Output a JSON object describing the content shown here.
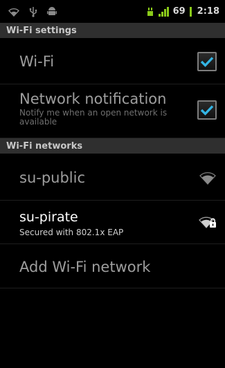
{
  "status_bar": {
    "battery_level": "69",
    "clock": "2:18",
    "icons": [
      "wifi-icon",
      "usb-icon",
      "android-debug-icon",
      "sim-icon",
      "signal-icon",
      "battery-icon"
    ]
  },
  "sections": {
    "wifi_settings": "Wi-Fi settings",
    "wifi_networks": "Wi-Fi networks"
  },
  "settings": {
    "wifi": {
      "label": "Wi-Fi",
      "checked": true
    },
    "network_notification": {
      "label": "Network notification",
      "summary": "Notify me when an open network is available",
      "checked": true
    }
  },
  "networks": [
    {
      "ssid": "su-public",
      "status": "",
      "secured": false,
      "icon": "wifi-signal-icon"
    },
    {
      "ssid": "su-pirate",
      "status": "Secured with 802.1x EAP",
      "secured": true,
      "icon": "wifi-secured-icon"
    }
  ],
  "add_network": {
    "label": "Add Wi-Fi network"
  },
  "colors": {
    "accent": "#33b5e5",
    "battery_green": "#8bcb1a",
    "header_bg": "#2f2f2f"
  }
}
